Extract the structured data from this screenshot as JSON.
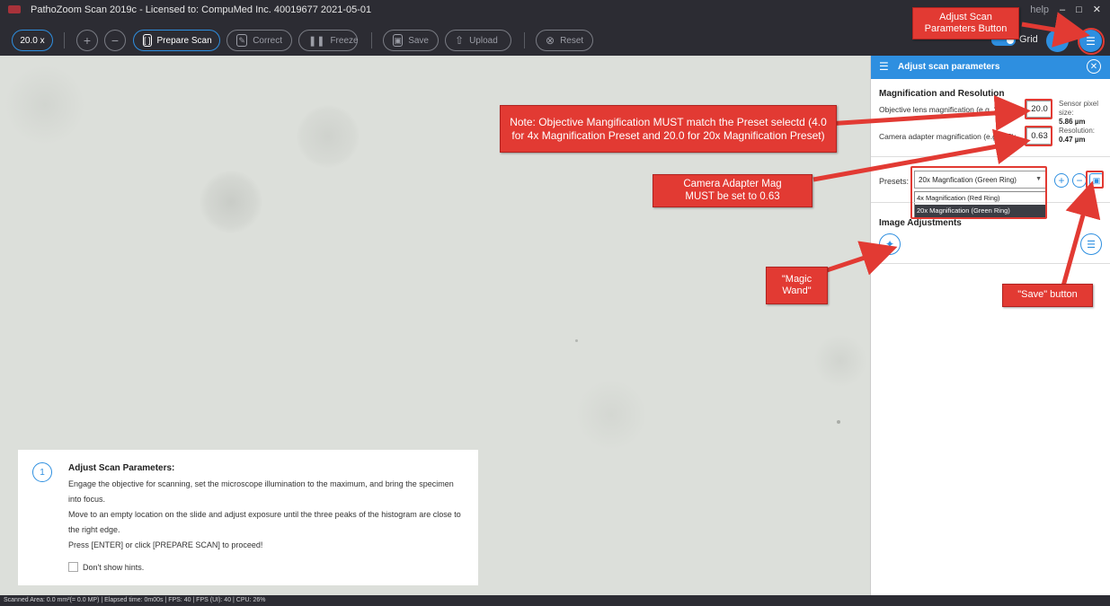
{
  "window": {
    "title": "PathoZoom Scan 2019c  - Licensed to:  CompuMed Inc. 40019677 2021-05-01",
    "help": "help",
    "minimize": "–",
    "restore": "□",
    "close": "✕"
  },
  "toolbar": {
    "zoom_label": "20.0 x",
    "zoom_in": "+",
    "zoom_out": "−",
    "prepare_scan": "Prepare Scan",
    "correct": "Correct",
    "freeze": "Freeze",
    "save": "Save",
    "upload": "Upload",
    "reset": "Reset",
    "grid_label": "Grid",
    "grid_on": true,
    "info": "i"
  },
  "panel": {
    "title": "Adjust scan parameters",
    "section1_title": "Magnification and Resolution",
    "objective_label": "Objective lens magnification (e.g. 20):",
    "objective_value": "20.0",
    "sensor_label": "Sensor pixel size:",
    "sensor_value": "5.86 µm",
    "camera_label": "Camera adapter magnification (e.g. 0.5):",
    "camera_value": "0.63",
    "resolution_label": "Resolution:",
    "resolution_value": "0.47 µm",
    "presets_label": "Presets:",
    "preset_selected": "20x Magnfication (Green Ring)",
    "preset_options": [
      "4x Magnification (Red Ring)",
      "20x Magnification (Green Ring)"
    ],
    "section2_title": "Image Adjustments"
  },
  "hint": {
    "number": "1",
    "title": "Adjust Scan Parameters:",
    "lines": [
      "Engage the objective for scanning, set the microscope illumination to the maximum, and bring the specimen into focus.",
      "Move to an empty location on the slide and adjust exposure until the three peaks of the histogram are close to the right edge.",
      "Press [ENTER] or click [PREPARE SCAN] to proceed!"
    ],
    "dont_show": "Don't show hints."
  },
  "status": {
    "text": "Scanned Area: 0.0 mm²(= 0.0 MP)  |  Elapsed time: 0m00s  |  FPS: 40  |  FPS (UI): 40  |  CPU: 26%"
  },
  "annotations": {
    "adjust_button": "Adjust Scan Parameters Button",
    "note": "Note: Objective Mangification MUST match the Preset selectd (4.0 for 4x Magnification Preset and 20.0 for 20x Magnification Preset)",
    "camera_note": "Camera Adapter Mag MUST be set to 0.63",
    "magic_wand": "\"Magic Wand\"",
    "save_button": "\"Save\" button"
  },
  "colors": {
    "accent": "#2e8fe0",
    "callout": "#e23a33",
    "titlebar": "#2c2c33",
    "viewer": "#dcdfda"
  }
}
